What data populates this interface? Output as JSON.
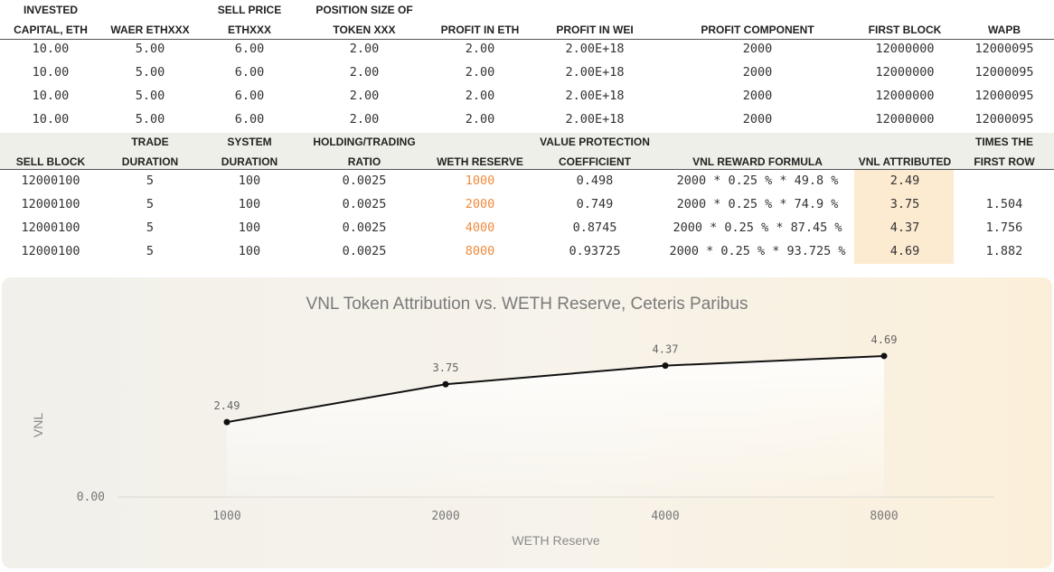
{
  "table1": {
    "headers": [
      [
        "INVESTED",
        "CAPITAL, ETH"
      ],
      [
        "",
        "WAER ETHXXX"
      ],
      [
        "SELL PRICE",
        "ETHXXX"
      ],
      [
        "POSITION SIZE OF",
        "TOKEN XXX"
      ],
      [
        "",
        "PROFIT IN ETH"
      ],
      [
        "",
        "PROFIT IN WEI"
      ],
      [
        "",
        "PROFIT COMPONENT"
      ],
      [
        "",
        "FIRST BLOCK"
      ],
      [
        "",
        "WAPB"
      ]
    ],
    "rows": [
      [
        "10.00",
        "5.00",
        "6.00",
        "2.00",
        "2.00",
        "2.00E+18",
        "2000",
        "12000000",
        "12000095"
      ],
      [
        "10.00",
        "5.00",
        "6.00",
        "2.00",
        "2.00",
        "2.00E+18",
        "2000",
        "12000000",
        "12000095"
      ],
      [
        "10.00",
        "5.00",
        "6.00",
        "2.00",
        "2.00",
        "2.00E+18",
        "2000",
        "12000000",
        "12000095"
      ],
      [
        "10.00",
        "5.00",
        "6.00",
        "2.00",
        "2.00",
        "2.00E+18",
        "2000",
        "12000000",
        "12000095"
      ]
    ]
  },
  "table2": {
    "headers": [
      [
        "",
        "SELL BLOCK"
      ],
      [
        "TRADE",
        "DURATION"
      ],
      [
        "SYSTEM",
        "DURATION"
      ],
      [
        "HOLDING/TRADING",
        "RATIO"
      ],
      [
        "",
        "WETH RESERVE"
      ],
      [
        "VALUE PROTECTION",
        "COEFFICIENT"
      ],
      [
        "",
        "VNL REWARD FORMULA"
      ],
      [
        "",
        "VNL ATTRIBUTED"
      ],
      [
        "TIMES THE",
        "FIRST ROW"
      ]
    ],
    "rows": [
      [
        "12000100",
        "5",
        "100",
        "0.0025",
        "1000",
        "0.498",
        "2000 * 0.25 % * 49.8 %",
        "2.49",
        ""
      ],
      [
        "12000100",
        "5",
        "100",
        "0.0025",
        "2000",
        "0.749",
        "2000 * 0.25 % * 74.9 %",
        "3.75",
        "1.504"
      ],
      [
        "12000100",
        "5",
        "100",
        "0.0025",
        "4000",
        "0.8745",
        "2000 * 0.25 % * 87.45 %",
        "4.37",
        "1.756"
      ],
      [
        "12000100",
        "5",
        "100",
        "0.0025",
        "8000",
        "0.93725",
        "2000 * 0.25 % * 93.725 %",
        "4.69",
        "1.882"
      ]
    ],
    "accent_color": "#f08a3a",
    "highlight_color": "#fcebd0"
  },
  "chart_data": {
    "type": "line",
    "title": "VNL Token Attribution vs. WETH Reserve, Ceteris Paribus",
    "xlabel": "WETH Reserve",
    "ylabel": "VNL",
    "categories": [
      "1000",
      "2000",
      "4000",
      "8000"
    ],
    "series": [
      {
        "values": [
          2.49,
          3.75,
          4.37,
          4.69
        ]
      }
    ],
    "data_labels": [
      "2.49",
      "3.75",
      "4.37",
      "4.69"
    ],
    "y_ticks": [
      "0.00"
    ],
    "ylim": [
      0,
      5.5
    ],
    "grid": false,
    "line_color": "#111111"
  }
}
